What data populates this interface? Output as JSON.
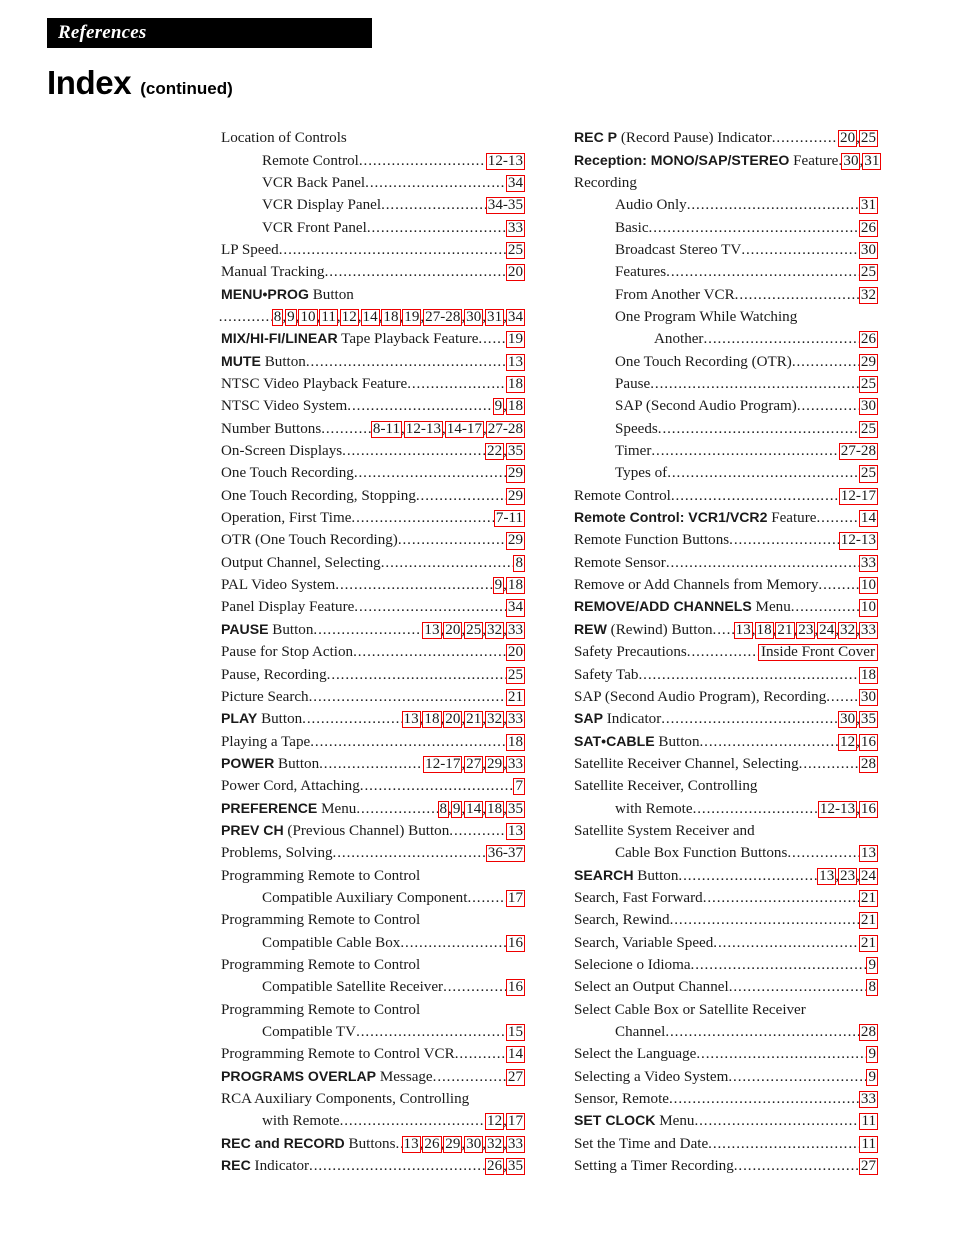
{
  "header": {
    "section_tab": "References",
    "title": "Index",
    "title_suffix": "(continued)"
  },
  "columns": {
    "left": [
      {
        "label": "Location of Controls",
        "level": 0,
        "pages": []
      },
      {
        "label": "Remote Control",
        "level": 1,
        "pages": [
          "12-13"
        ]
      },
      {
        "label": "VCR Back Panel",
        "level": 1,
        "pages": [
          "34"
        ]
      },
      {
        "label": "VCR Display Panel",
        "level": 1,
        "pages": [
          "34-35"
        ]
      },
      {
        "label": "VCR Front Panel",
        "level": 1,
        "pages": [
          "33"
        ]
      },
      {
        "label": "LP Speed",
        "level": 0,
        "pages": [
          "25"
        ]
      },
      {
        "label": "Manual Tracking",
        "level": 0,
        "pages": [
          "20"
        ]
      },
      {
        "label": "MENU•PROG Button",
        "level": 0,
        "bold": "MENU•PROG",
        "plain": " Button",
        "pages": []
      },
      {
        "label": "",
        "level": 0,
        "continuation": true,
        "pages": [
          "8",
          "9",
          "10",
          "11",
          "12",
          "14",
          "18",
          "19",
          "27-28",
          "30",
          "31",
          "34"
        ]
      },
      {
        "label": "MIX/HI-FI/LINEAR Tape Playback Feature",
        "level": 0,
        "bold": "MIX/HI-FI/LINEAR",
        "plain": " Tape Playback Feature",
        "pages": [
          "19"
        ]
      },
      {
        "label": "MUTE Button",
        "level": 0,
        "bold": "MUTE",
        "plain": " Button",
        "pages": [
          "13"
        ]
      },
      {
        "label": "NTSC Video Playback Feature",
        "level": 0,
        "pages": [
          "18"
        ]
      },
      {
        "label": "NTSC Video System",
        "level": 0,
        "pages": [
          "9",
          "18"
        ]
      },
      {
        "label": "Number Buttons",
        "level": 0,
        "pages": [
          "8-11",
          "12-13",
          "14-17",
          "27-28"
        ]
      },
      {
        "label": "On-Screen Displays",
        "level": 0,
        "pages": [
          "22",
          "35"
        ]
      },
      {
        "label": "One Touch Recording",
        "level": 0,
        "pages": [
          "29"
        ]
      },
      {
        "label": "One Touch Recording, Stopping",
        "level": 0,
        "pages": [
          "29"
        ]
      },
      {
        "label": "Operation, First Time",
        "level": 0,
        "pages": [
          "7-11"
        ]
      },
      {
        "label": "OTR (One Touch Recording)",
        "level": 0,
        "pages": [
          "29"
        ]
      },
      {
        "label": "Output Channel, Selecting",
        "level": 0,
        "pages": [
          "8"
        ]
      },
      {
        "label": "PAL Video System",
        "level": 0,
        "pages": [
          "9",
          "18"
        ]
      },
      {
        "label": "Panel Display Feature",
        "level": 0,
        "pages": [
          "34"
        ]
      },
      {
        "label": "PAUSE Button",
        "level": 0,
        "bold": "PAUSE",
        "plain": " Button",
        "pages": [
          "13",
          "20",
          "25",
          "32",
          "33"
        ]
      },
      {
        "label": "Pause for Stop Action",
        "level": 0,
        "pages": [
          "20"
        ]
      },
      {
        "label": "Pause, Recording",
        "level": 0,
        "pages": [
          "25"
        ]
      },
      {
        "label": "Picture Search",
        "level": 0,
        "pages": [
          "21"
        ]
      },
      {
        "label": "PLAY Button",
        "level": 0,
        "bold": "PLAY",
        "plain": " Button",
        "pages": [
          "13",
          "18",
          "20",
          "21",
          "32",
          "33"
        ]
      },
      {
        "label": "Playing a Tape",
        "level": 0,
        "pages": [
          "18"
        ]
      },
      {
        "label": "POWER Button",
        "level": 0,
        "bold": "POWER",
        "plain": " Button",
        "pages": [
          "12-17",
          "27",
          "29",
          "33"
        ]
      },
      {
        "label": "Power Cord, Attaching",
        "level": 0,
        "pages": [
          "7"
        ]
      },
      {
        "label": "PREFERENCE Menu",
        "level": 0,
        "bold": "PREFERENCE",
        "plain": " Menu",
        "pages": [
          "8",
          "9",
          "14",
          "18",
          "35"
        ]
      },
      {
        "label": "PREV CH (Previous Channel) Button",
        "level": 0,
        "bold": "PREV CH",
        "plain": " (Previous Channel) Button",
        "pages": [
          "13"
        ]
      },
      {
        "label": "Problems, Solving",
        "level": 0,
        "pages": [
          "36-37"
        ]
      },
      {
        "label": "Programming Remote to Control",
        "level": 0,
        "pages": []
      },
      {
        "label": "Compatible Auxiliary Component",
        "level": 1,
        "pages": [
          "17"
        ]
      },
      {
        "label": "Programming Remote to Control",
        "level": 0,
        "pages": []
      },
      {
        "label": "Compatible Cable Box",
        "level": 1,
        "pages": [
          "16"
        ]
      },
      {
        "label": "Programming Remote to Control",
        "level": 0,
        "pages": []
      },
      {
        "label": "Compatible Satellite Receiver",
        "level": 1,
        "pages": [
          "16"
        ]
      },
      {
        "label": "Programming Remote to Control",
        "level": 0,
        "pages": []
      },
      {
        "label": "Compatible TV",
        "level": 1,
        "pages": [
          "15"
        ]
      },
      {
        "label": "Programming Remote to Control VCR",
        "level": 0,
        "pages": [
          "14"
        ]
      },
      {
        "label": "PROGRAMS OVERLAP Message",
        "level": 0,
        "bold": "PROGRAMS OVERLAP",
        "plain": " Message",
        "pages": [
          "27"
        ]
      },
      {
        "label": "RCA Auxiliary Components, Controlling",
        "level": 0,
        "pages": []
      },
      {
        "label": "with Remote",
        "level": 1,
        "pages": [
          "12",
          "17"
        ]
      },
      {
        "label": "REC and RECORD Buttons",
        "level": 0,
        "bold": "REC and RECORD",
        "plain": " Buttons",
        "pages": [
          "13",
          "26",
          "29",
          "30",
          "32",
          "33"
        ]
      },
      {
        "label": "REC Indicator",
        "level": 0,
        "bold": "REC",
        "plain": " Indicator",
        "pages": [
          "26",
          "35"
        ]
      }
    ],
    "right": [
      {
        "label": "REC P (Record Pause) Indicator",
        "level": 0,
        "bold": "REC P",
        "plain": " (Record Pause) Indicator",
        "pages": [
          "20",
          "25"
        ]
      },
      {
        "label": "Reception: MONO/SAP/STEREO Feature",
        "level": 0,
        "bold": "Reception: MONO/SAP/STEREO",
        "plain": " Feature",
        "pages": [
          "30",
          "31"
        ]
      },
      {
        "label": "Recording",
        "level": 0,
        "pages": []
      },
      {
        "label": "Audio Only",
        "level": 1,
        "pages": [
          "31"
        ]
      },
      {
        "label": "Basic",
        "level": 1,
        "pages": [
          "26"
        ]
      },
      {
        "label": "Broadcast Stereo TV",
        "level": 1,
        "pages": [
          "30"
        ]
      },
      {
        "label": "Features",
        "level": 1,
        "pages": [
          "25"
        ]
      },
      {
        "label": "From Another VCR",
        "level": 1,
        "pages": [
          "32"
        ]
      },
      {
        "label": "One Program While Watching",
        "level": 1,
        "pages": []
      },
      {
        "label": "Another",
        "level": 2,
        "pages": [
          "26"
        ]
      },
      {
        "label": "One Touch Recording (OTR)",
        "level": 1,
        "pages": [
          "29"
        ]
      },
      {
        "label": "Pause",
        "level": 1,
        "pages": [
          "25"
        ]
      },
      {
        "label": "SAP (Second Audio Program)",
        "level": 1,
        "pages": [
          "30"
        ]
      },
      {
        "label": "Speeds",
        "level": 1,
        "pages": [
          "25"
        ]
      },
      {
        "label": "Timer",
        "level": 1,
        "pages": [
          "27-28"
        ]
      },
      {
        "label": "Types of",
        "level": 1,
        "pages": [
          "25"
        ]
      },
      {
        "label": "Remote Control",
        "level": 0,
        "pages": [
          "12-17"
        ]
      },
      {
        "label": "Remote Control: VCR1/VCR2 Feature",
        "level": 0,
        "bold": "Remote Control: VCR1/VCR2",
        "plain": " Feature",
        "pages": [
          "14"
        ]
      },
      {
        "label": "Remote Function Buttons",
        "level": 0,
        "pages": [
          "12-13"
        ]
      },
      {
        "label": "Remote Sensor",
        "level": 0,
        "pages": [
          "33"
        ]
      },
      {
        "label": "Remove or Add Channels from Memory",
        "level": 0,
        "pages": [
          "10"
        ]
      },
      {
        "label": "REMOVE/ADD CHANNELS Menu",
        "level": 0,
        "bold": "REMOVE/ADD CHANNELS",
        "plain": " Menu",
        "pages": [
          "10"
        ]
      },
      {
        "label": "REW (Rewind) Button",
        "level": 0,
        "bold": "REW",
        "plain": " (Rewind) Button",
        "pages": [
          "13",
          "18",
          "21",
          "23",
          "24",
          "32",
          "33"
        ]
      },
      {
        "label": "Safety Precautions",
        "level": 0,
        "pages": [
          "Inside Front Cover"
        ]
      },
      {
        "label": "Safety Tab",
        "level": 0,
        "pages": [
          "18"
        ]
      },
      {
        "label": "SAP (Second Audio Program), Recording",
        "level": 0,
        "pages": [
          "30"
        ]
      },
      {
        "label": "SAP Indicator",
        "level": 0,
        "bold": "SAP",
        "plain": " Indicator",
        "pages": [
          "30",
          "35"
        ]
      },
      {
        "label": "SAT•CABLE Button",
        "level": 0,
        "bold": "SAT•CABLE",
        "plain": " Button",
        "pages": [
          "12",
          "16"
        ]
      },
      {
        "label": "Satellite Receiver Channel, Selecting",
        "level": 0,
        "pages": [
          "28"
        ]
      },
      {
        "label": "Satellite Receiver, Controlling",
        "level": 0,
        "pages": []
      },
      {
        "label": "with Remote",
        "level": 1,
        "pages": [
          "12-13",
          "16"
        ]
      },
      {
        "label": "Satellite System Receiver and",
        "level": 0,
        "pages": []
      },
      {
        "label": "Cable Box Function Buttons",
        "level": 1,
        "pages": [
          "13"
        ]
      },
      {
        "label": "SEARCH Button",
        "level": 0,
        "bold": "SEARCH",
        "plain": " Button",
        "pages": [
          "13",
          "23",
          "24"
        ]
      },
      {
        "label": "Search, Fast Forward",
        "level": 0,
        "pages": [
          "21"
        ]
      },
      {
        "label": "Search, Rewind",
        "level": 0,
        "pages": [
          "21"
        ]
      },
      {
        "label": "Search, Variable Speed",
        "level": 0,
        "pages": [
          "21"
        ]
      },
      {
        "label": "Selecione o Idioma",
        "level": 0,
        "pages": [
          "9"
        ]
      },
      {
        "label": "Select an Output Channel",
        "level": 0,
        "pages": [
          "8"
        ]
      },
      {
        "label": "Select Cable Box or Satellite Receiver",
        "level": 0,
        "pages": []
      },
      {
        "label": "Channel",
        "level": 1,
        "pages": [
          "28"
        ]
      },
      {
        "label": "Select the Language",
        "level": 0,
        "pages": [
          "9"
        ]
      },
      {
        "label": "Selecting a Video System",
        "level": 0,
        "pages": [
          "9"
        ]
      },
      {
        "label": "Sensor, Remote",
        "level": 0,
        "pages": [
          "33"
        ]
      },
      {
        "label": "SET CLOCK Menu",
        "level": 0,
        "bold": "SET CLOCK",
        "plain": " Menu",
        "pages": [
          "11"
        ]
      },
      {
        "label": "Set the Time and Date",
        "level": 0,
        "pages": [
          "11"
        ]
      },
      {
        "label": "Setting a Timer Recording",
        "level": 0,
        "pages": [
          "27"
        ]
      }
    ]
  },
  "annotation": {
    "highlight_color": "#ee0000",
    "description": "page-number-boxes"
  }
}
